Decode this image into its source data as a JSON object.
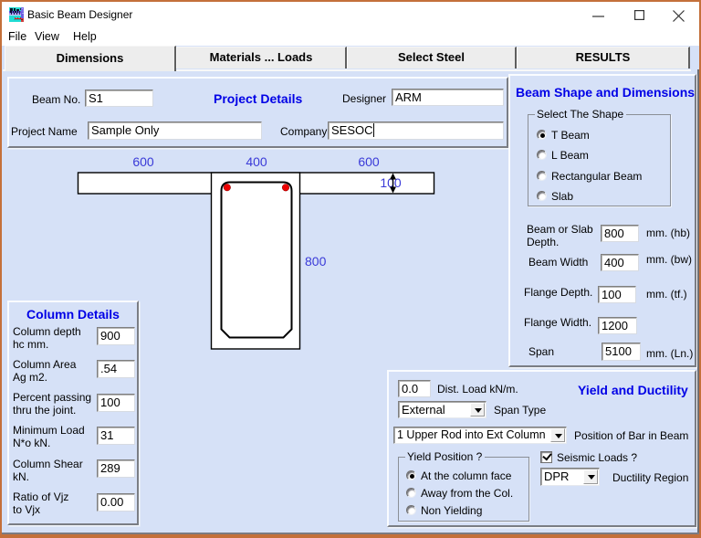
{
  "window": {
    "title": "Basic Beam Designer",
    "controls": {
      "minimize": "minimize",
      "maximize": "maximize",
      "close": "close"
    }
  },
  "menu": {
    "items": [
      "File",
      "View",
      "Help"
    ]
  },
  "tabs": [
    {
      "label": "Dimensions",
      "selected": true
    },
    {
      "label": "Materials ... Loads",
      "selected": false
    },
    {
      "label": "Select Steel",
      "selected": false
    },
    {
      "label": "RESULTS",
      "selected": false
    }
  ],
  "project": {
    "title": "Project Details",
    "beam_no_label": "Beam No.",
    "beam_no": "S1",
    "designer_label": "Designer",
    "designer": "ARM",
    "project_name_label": "Project Name",
    "project_name": "Sample Only",
    "company_label": "Company",
    "company": "SESOC"
  },
  "drawing": {
    "dim_left": "600",
    "dim_mid": "400",
    "dim_right": "600",
    "dim_flange": "100",
    "dim_depth": "800"
  },
  "column_details": {
    "title": "Column Details",
    "rows": [
      {
        "label": "Column depth\nhc mm.",
        "value": "900"
      },
      {
        "label": "Column Area\nAg m2.",
        "value": ".54"
      },
      {
        "label": "Percent passing\nthru the joint.",
        "value": "100"
      },
      {
        "label": "Minimum Load\nN*o kN.",
        "value": "31"
      },
      {
        "label": "Column Shear\nkN.",
        "value": "289"
      },
      {
        "label": "Ratio of Vjz\nto Vjx",
        "value": "0.00"
      }
    ]
  },
  "shape_panel": {
    "title": "Beam Shape and Dimensions",
    "group_label": "Select The Shape",
    "options": [
      {
        "label": "T Beam",
        "selected": true
      },
      {
        "label": "L Beam",
        "selected": false
      },
      {
        "label": "Rectangular Beam",
        "selected": false
      },
      {
        "label": "Slab",
        "selected": false
      }
    ],
    "fields": [
      {
        "label": "Beam or Slab\nDepth.",
        "value": "800",
        "unit": "mm. (hb)"
      },
      {
        "label": "Beam Width",
        "value": "400",
        "unit": "mm. (bw)"
      },
      {
        "label": "Flange Depth.",
        "value": "100",
        "unit": "mm. (tf.)"
      },
      {
        "label": "Flange Width.",
        "value": "1200"
      },
      {
        "label": "Span",
        "value": "5100",
        "unit": "mm. (Ln.)"
      }
    ]
  },
  "yield_panel": {
    "title": "Yield and Ductility",
    "dist_load": "0.0",
    "dist_load_label": "Dist. Load kN/m.",
    "span_type": "External",
    "span_type_label": "Span Type",
    "bar_position": "1 Upper Rod into Ext Column",
    "bar_position_label": "Position of Bar in Beam",
    "yield_group_label": "Yield Position ?",
    "yield_options": [
      {
        "label": "At the column face",
        "selected": true
      },
      {
        "label": "Away from the Col.",
        "selected": false
      },
      {
        "label": "Non Yielding",
        "selected": false
      }
    ],
    "seismic_label": "Seismic Loads ?",
    "seismic_checked": true,
    "ductility": "DPR",
    "ductility_label": "Ductility Region"
  },
  "colors": {
    "frame": "#c4703a",
    "client_bg": "#d6e1f7",
    "accent_blue": "#0000e6",
    "dim_blue": "#3a3ad8",
    "rebar_red": "#ee0000"
  }
}
